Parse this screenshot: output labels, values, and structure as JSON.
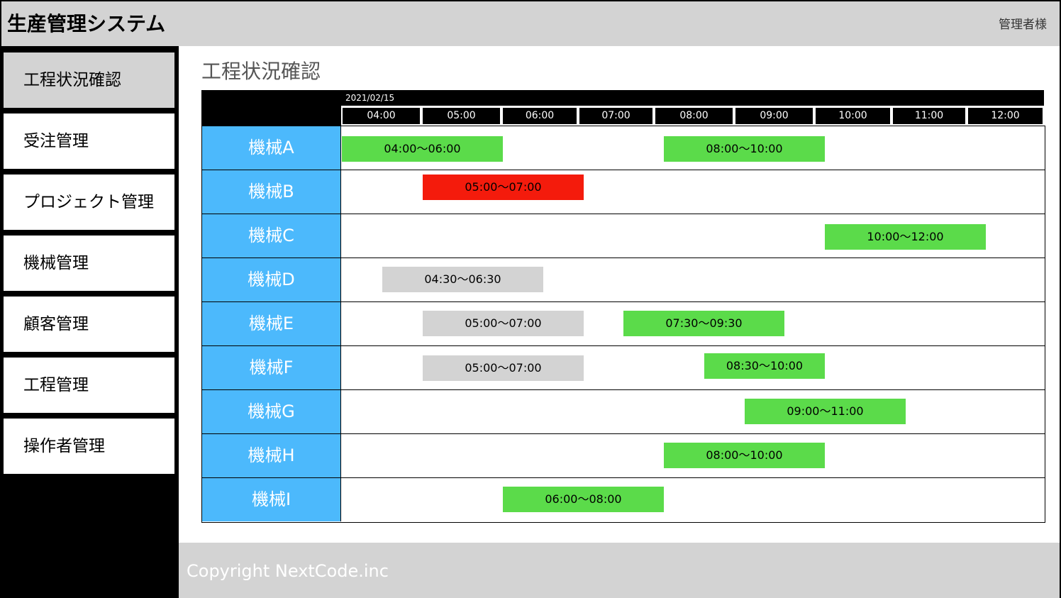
{
  "header": {
    "title": "生産管理システム",
    "user": "管理者様"
  },
  "sidebar": {
    "items": [
      {
        "label": "工程状況確認",
        "active": true
      },
      {
        "label": "受注管理",
        "active": false
      },
      {
        "label": "プロジェクト管理",
        "active": false
      },
      {
        "label": "機械管理",
        "active": false
      },
      {
        "label": "顧客管理",
        "active": false
      },
      {
        "label": "工程管理",
        "active": false
      },
      {
        "label": "操作者管理",
        "active": false
      }
    ]
  },
  "main": {
    "title": "工程状況確認"
  },
  "gantt": {
    "date": "2021/02/15",
    "hours": [
      "04:00",
      "05:00",
      "06:00",
      "07:00",
      "08:00",
      "09:00",
      "10:00",
      "11:00",
      "12:00"
    ],
    "colors": {
      "green": "#5bdb4a",
      "red": "#f41b0c",
      "gray": "#d3d3d3",
      "machine": "#4cb9fc"
    },
    "machines": [
      {
        "name": "機械A",
        "tasks": [
          {
            "label": "04:00〜06:00",
            "status": "green"
          },
          {
            "label": "08:00〜10:00",
            "status": "green"
          }
        ]
      },
      {
        "name": "機械B",
        "tasks": [
          {
            "label": "05:00〜07:00",
            "status": "red"
          }
        ]
      },
      {
        "name": "機械C",
        "tasks": [
          {
            "label": "10:00〜12:00",
            "status": "green"
          }
        ]
      },
      {
        "name": "機械D",
        "tasks": [
          {
            "label": "04:30〜06:30",
            "status": "gray"
          }
        ]
      },
      {
        "name": "機械E",
        "tasks": [
          {
            "label": "05:00〜07:00",
            "status": "gray"
          },
          {
            "label": "07:30〜09:30",
            "status": "green"
          }
        ]
      },
      {
        "name": "機械F",
        "tasks": [
          {
            "label": "05:00〜07:00",
            "status": "gray"
          },
          {
            "label": "08:30〜10:00",
            "status": "green"
          }
        ]
      },
      {
        "name": "機械G",
        "tasks": [
          {
            "label": "09:00〜11:00",
            "status": "green"
          }
        ]
      },
      {
        "name": "機械H",
        "tasks": [
          {
            "label": "08:00〜10:00",
            "status": "green"
          }
        ]
      },
      {
        "name": "機械I",
        "tasks": [
          {
            "label": "06:00〜08:00",
            "status": "green"
          }
        ]
      }
    ]
  },
  "footer": {
    "copyright": "Copyright NextCode.inc"
  }
}
